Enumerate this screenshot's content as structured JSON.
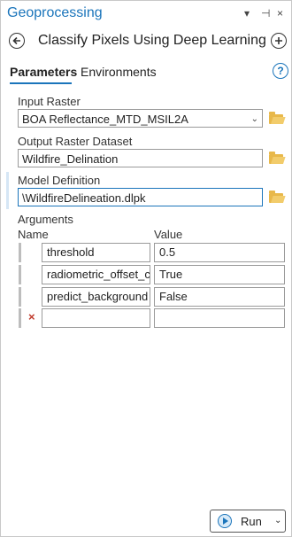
{
  "pane": {
    "title": "Geoprocessing",
    "controls": [
      "▾",
      "⊣",
      "×"
    ]
  },
  "tool": {
    "title": "Classify Pixels Using Deep Learning"
  },
  "tabs": [
    {
      "label": "Parameters",
      "active": true
    },
    {
      "label": "Environments",
      "active": false
    }
  ],
  "params": {
    "input_raster_label": "Input Raster",
    "input_raster_value": "BOA Reflectance_MTD_MSIL2A",
    "output_raster_label": "Output Raster Dataset",
    "output_raster_value": "Wildfire_Delination",
    "model_definition_label": "Model Definition",
    "model_definition_value": "\\WildfireDelineation.dlpk"
  },
  "arguments": {
    "section_label": "Arguments",
    "col_name": "Name",
    "col_value": "Value",
    "rows": [
      {
        "name": "threshold",
        "value": "0.5"
      },
      {
        "name": "radiometric_offset_co",
        "value": "True"
      },
      {
        "name": "predict_background",
        "value": "False"
      },
      {
        "name": "",
        "value": ""
      }
    ]
  },
  "run_button": {
    "label": "Run"
  },
  "colors": {
    "accent": "#1b75bb",
    "folder": "#e8b84a",
    "remove": "#c0392b"
  }
}
